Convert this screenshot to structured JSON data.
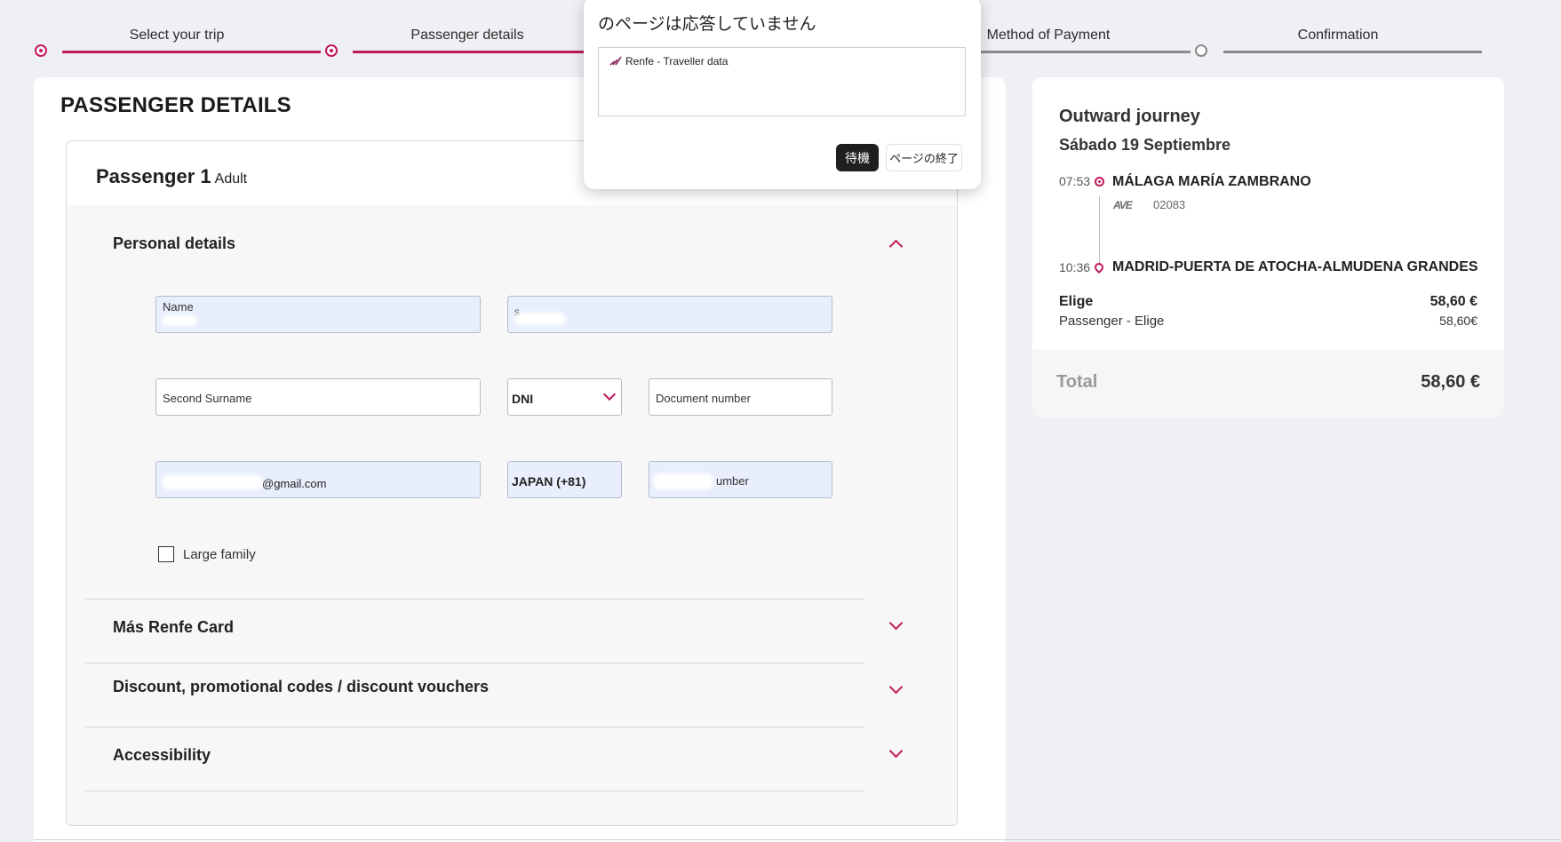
{
  "stepper": {
    "steps": [
      {
        "label": "Select your trip",
        "state": "done"
      },
      {
        "label": "Passenger details",
        "state": "current"
      },
      {
        "label": "Method of Payment",
        "state": "pending"
      },
      {
        "label": "Confirmation",
        "state": "pending"
      }
    ],
    "accent": "#c2185b"
  },
  "main": {
    "title": "PASSENGER DETAILS",
    "passenger": {
      "title": "Passenger 1",
      "type": "Adult"
    },
    "personal": {
      "title": "Personal details",
      "name_label": "Name",
      "surname_fragment": "S",
      "second_surname_placeholder": "Second Surname",
      "doc_type": "DNI",
      "doc_number_placeholder": "Document number",
      "email_suffix": "@gmail.com",
      "phone_prefix": "JAPAN (+81)",
      "phone_suffix": "umber",
      "large_family_label": "Large family"
    },
    "sections": [
      {
        "title": "Más Renfe Card"
      },
      {
        "title": "Discount, promotional codes / discount vouchers"
      },
      {
        "title": "Accessibility"
      }
    ]
  },
  "journey": {
    "title": "Outward journey",
    "date": "Sábado 19 Septiembre",
    "departure_time": "07:53",
    "departure_station": "MÁLAGA MARÍA ZAMBRANO",
    "train_brand": "AVE",
    "train_number": "02083",
    "arrival_time": "10:36",
    "arrival_station": "MADRID-PUERTA DE ATOCHA-ALMUDENA GRANDES",
    "fare_name": "Elige",
    "fare_price": "58,60 €",
    "fare_detail": "Passenger - Elige",
    "fare_detail_price": "58,60€",
    "total_label": "Total",
    "total_value": "58,60 €"
  },
  "dialog": {
    "title": "のページは応答していません",
    "page_item": "Renfe - Traveller data",
    "wait_button": "待機",
    "exit_button": "ページの終了"
  }
}
